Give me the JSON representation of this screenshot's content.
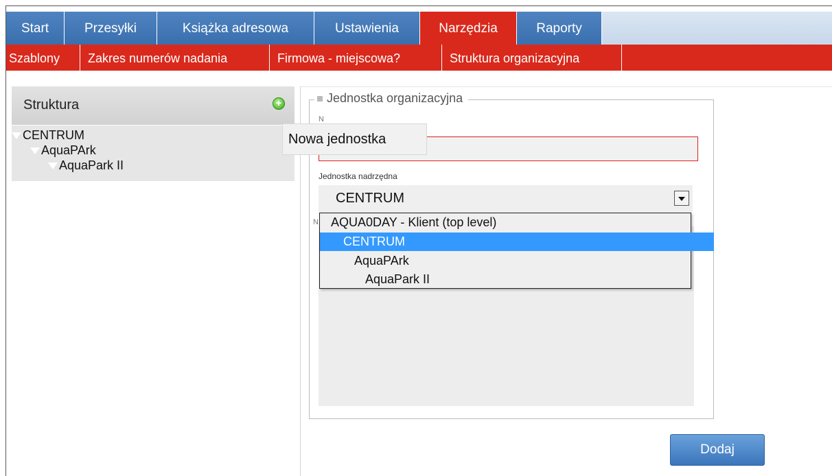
{
  "tabs": [
    {
      "label": "Start",
      "active": false
    },
    {
      "label": "Przesyłki",
      "active": false
    },
    {
      "label": "Książka adresowa",
      "active": false
    },
    {
      "label": "Ustawienia",
      "active": false
    },
    {
      "label": "Narzędzia",
      "active": true
    },
    {
      "label": "Raporty",
      "active": false
    }
  ],
  "submenu": [
    "Szablony",
    "Zakres numerów nadania",
    "Firmowa - miejscowa?",
    "Struktura organizacyjna"
  ],
  "structure": {
    "title": "Struktura",
    "add_tooltip": "Nowa jednostka",
    "tree": [
      {
        "label": "CENTRUM",
        "level": 0
      },
      {
        "label": "AquaPArk",
        "level": 1
      },
      {
        "label": "AquaPark II",
        "level": 2
      }
    ]
  },
  "form": {
    "legend": "Jednostka organizacyjna",
    "name_label": "N",
    "name_value": "",
    "parent_label": "Jednostka nadrzędna",
    "parent_value": "CENTRUM",
    "notes_label": "N",
    "parent_options": [
      {
        "label": "AQUA0DAY - Klient (top level)",
        "level": 0,
        "selected": false
      },
      {
        "label": "CENTRUM",
        "level": 1,
        "selected": true
      },
      {
        "label": "AquaPArk",
        "level": 2,
        "selected": false
      },
      {
        "label": "AquaPark II",
        "level": 3,
        "selected": false
      }
    ],
    "submit_label": "Dodaj"
  },
  "colors": {
    "tab_blue": "#3a6fae",
    "active_red": "#d9291c",
    "selection_blue": "#3399ff"
  }
}
